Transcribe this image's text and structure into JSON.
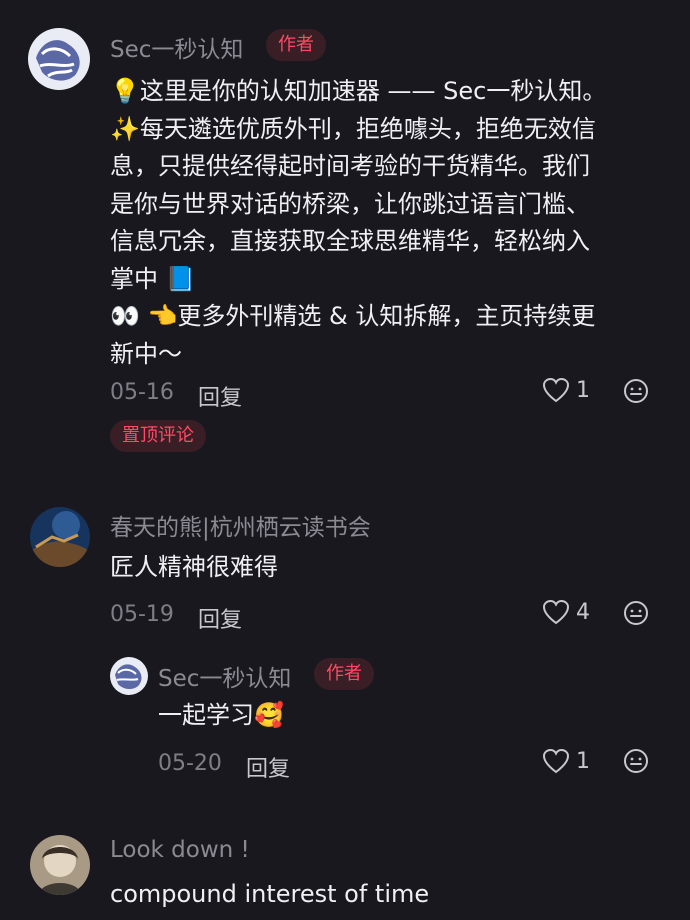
{
  "comments": [
    {
      "name": "Sec一秒认知",
      "badge": "作者",
      "lines": [
        "这里是你的认知加速器 —— Sec一秒认知。",
        "每天遴选优质外刊，拒绝噱头，拒绝无效信",
        "息，只提供经得起时间考验的干货精华。我们",
        "是你与世界对话的桥梁，让你跳过语言门槛、",
        "信息冗余，直接获取全球思维精华，轻松纳入",
        "掌中",
        "更多外刊精选 & 认知拆解，主页持续更",
        "新中～"
      ],
      "emojis": {
        "line0": "💡",
        "line1": "✨",
        "line5": "📘",
        "line6a": "👀",
        "line6b": "👈"
      },
      "date": "05-16",
      "reply_label": "回复",
      "likes": "1",
      "pinned_label": "置顶评论"
    },
    {
      "name": "春天的熊|杭州栖云读书会",
      "text": "匠人精神很难得",
      "date": "05-19",
      "reply_label": "回复",
      "likes": "4"
    },
    {
      "name": "Sec一秒认知",
      "badge": "作者",
      "text": "一起学习",
      "emoji": "🥰",
      "date": "05-20",
      "reply_label": "回复",
      "likes": "1"
    },
    {
      "name": "Look down !",
      "text": "compound interest of time"
    }
  ],
  "icons": {
    "like": "heart-outline-icon",
    "emoji": "smiley-icon"
  },
  "colors": {
    "background": "#19181f",
    "accent": "#ff4a64",
    "badge_bg": "#3a1e26",
    "muted": "#8b8a92"
  }
}
